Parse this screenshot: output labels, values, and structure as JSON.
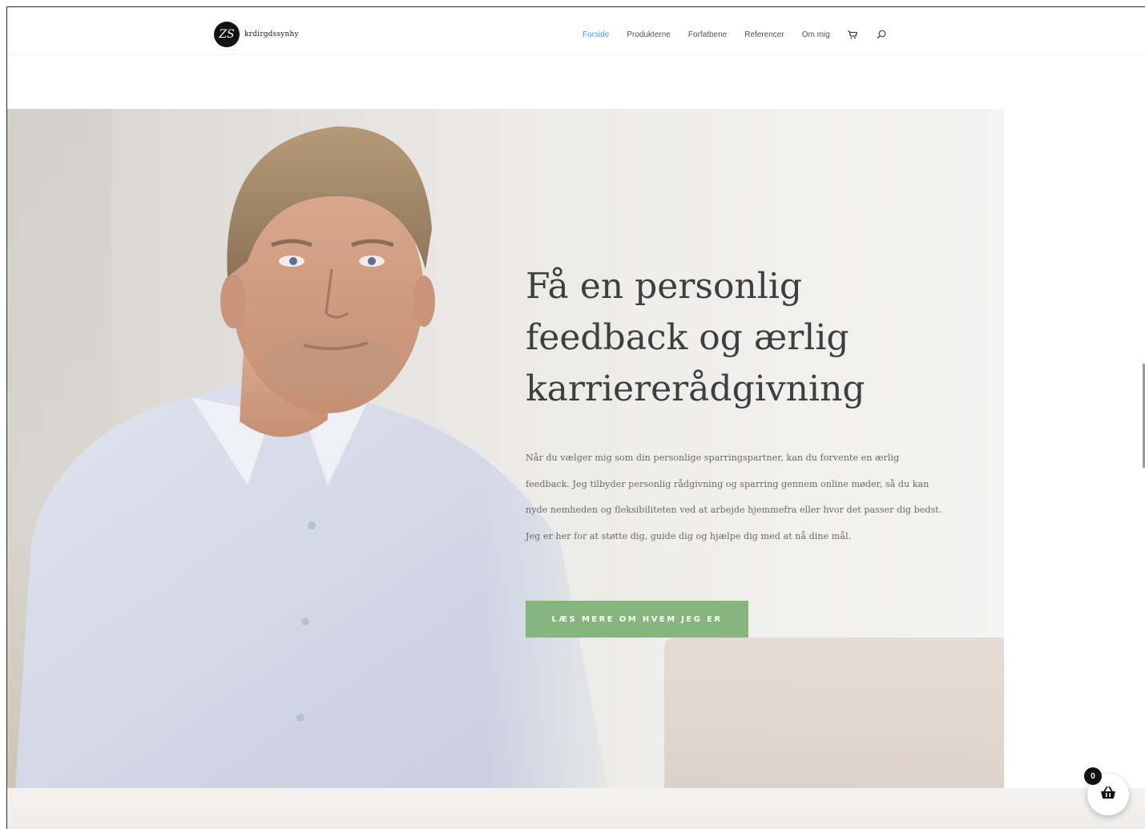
{
  "brand": {
    "logo_letter": "ZS",
    "logo_text": "krdirgdssynhy"
  },
  "nav": {
    "items": [
      {
        "label": "Forside",
        "active": true
      },
      {
        "label": "Produkterne",
        "active": false
      },
      {
        "label": "Forfatbene",
        "active": false
      },
      {
        "label": "Referencer",
        "active": false
      },
      {
        "label": "Om mig",
        "active": false
      }
    ],
    "icons": [
      "cart-icon",
      "search-icon"
    ]
  },
  "hero": {
    "title": "Få en personlig feedback og ærlig karriererådgivning",
    "body": "Når du vælger mig som din personlige sparringspartner, kan du forvente en ærlig feedback. Jeg tilbyder personlig rådgivning og sparring gennem online møder, så du kan nyde nemheden og fleksibiliteten ved at arbejde hjemmefra eller hvor det passer dig bedst. Jeg er her for at støtte dig, guide dig og hjælpe dig med at nå dine mål.",
    "cta_label": "LÆS MERE OM HVEM JEG ER"
  },
  "cart": {
    "count": "0",
    "icon": "basket-icon"
  },
  "colors": {
    "accent": "#2ea3f2",
    "cta": "#87b57e",
    "heading": "#3e3e3e"
  }
}
